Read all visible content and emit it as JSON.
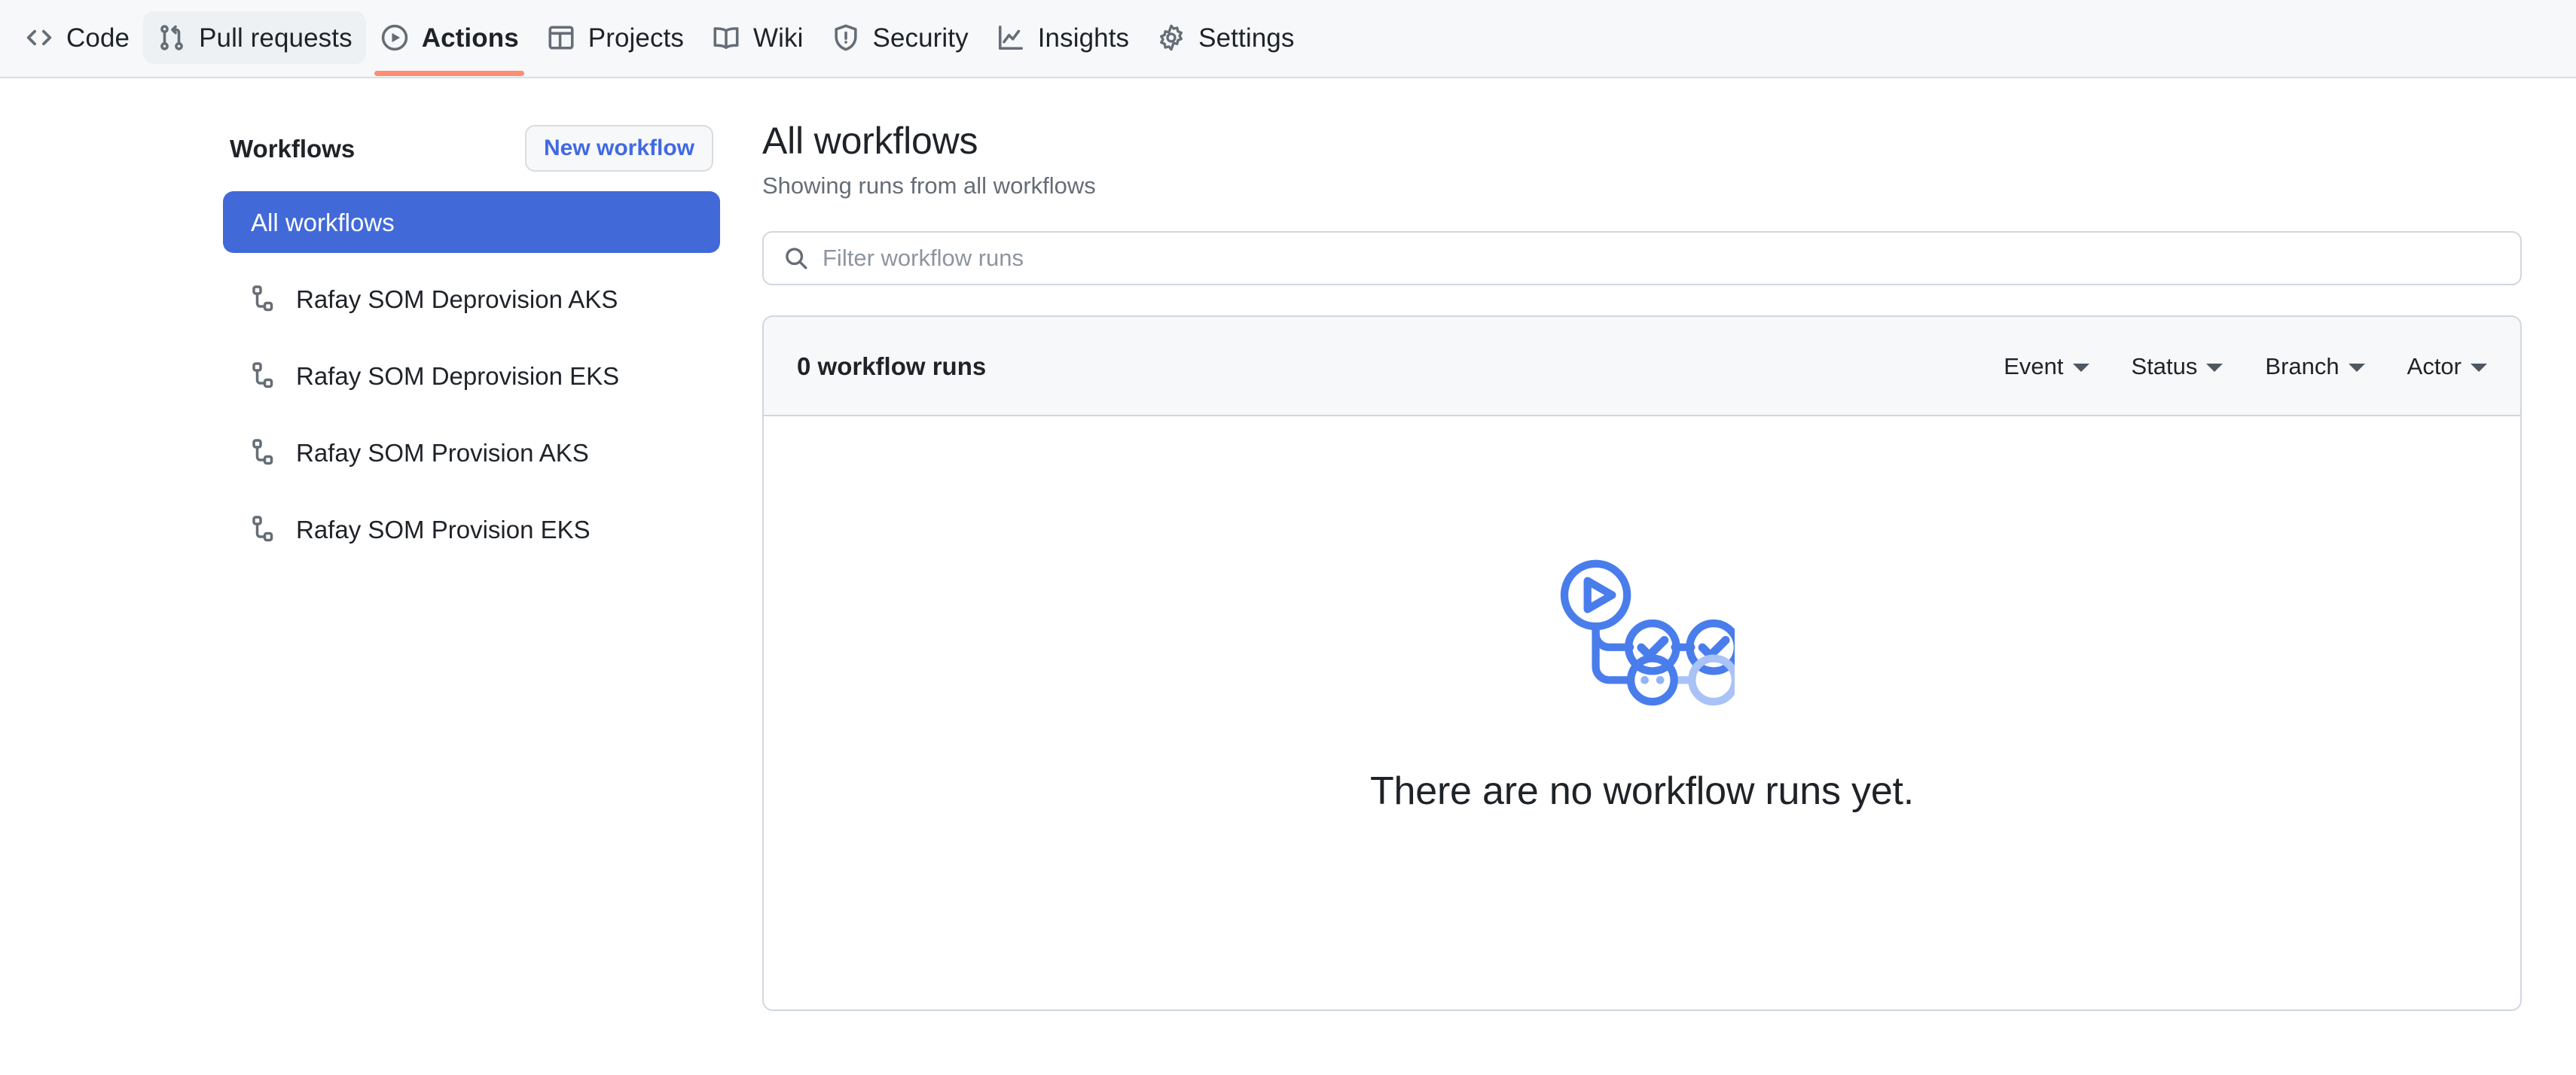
{
  "repo_nav": {
    "items": [
      {
        "label": "Code",
        "icon": "code-icon",
        "active": false,
        "hover": false
      },
      {
        "label": "Pull requests",
        "icon": "git-pull-request-icon",
        "active": false,
        "hover": true
      },
      {
        "label": "Actions",
        "icon": "play-circle-icon",
        "active": true,
        "hover": false
      },
      {
        "label": "Projects",
        "icon": "table-icon",
        "active": false,
        "hover": false
      },
      {
        "label": "Wiki",
        "icon": "book-icon",
        "active": false,
        "hover": false
      },
      {
        "label": "Security",
        "icon": "shield-alert-icon",
        "active": false,
        "hover": false
      },
      {
        "label": "Insights",
        "icon": "graph-icon",
        "active": false,
        "hover": false
      },
      {
        "label": "Settings",
        "icon": "gear-icon",
        "active": false,
        "hover": false
      }
    ],
    "active_underline_color": "#fd8c73"
  },
  "sidebar": {
    "title": "Workflows",
    "new_workflow_label": "New workflow",
    "new_workflow_color": "#4169e1",
    "selected_color": "#4169d8",
    "items": [
      {
        "label": "All workflows",
        "icon": null,
        "selected": true
      },
      {
        "label": "Rafay SOM Deprovision AKS",
        "icon": "workflow-icon",
        "selected": false
      },
      {
        "label": "Rafay SOM Deprovision EKS",
        "icon": "workflow-icon",
        "selected": false
      },
      {
        "label": "Rafay SOM Provision AKS",
        "icon": "workflow-icon",
        "selected": false
      },
      {
        "label": "Rafay SOM Provision EKS",
        "icon": "workflow-icon",
        "selected": false
      }
    ]
  },
  "main": {
    "title": "All workflows",
    "subtitle": "Showing runs from all workflows",
    "filter": {
      "icon": "search-icon",
      "placeholder": "Filter workflow runs",
      "value": ""
    },
    "runs": {
      "count_label": "0 workflow runs",
      "filters": [
        {
          "label": "Event",
          "icon": "chevron-down-icon"
        },
        {
          "label": "Status",
          "icon": "chevron-down-icon"
        },
        {
          "label": "Branch",
          "icon": "chevron-down-icon"
        },
        {
          "label": "Actor",
          "icon": "chevron-down-icon"
        }
      ],
      "empty_state": {
        "illustration": "workflow-runs-empty-icon",
        "message": "There are no workflow runs yet.",
        "accent_color": "#4a7dec",
        "accent_faded_color": "#a9c3f7"
      }
    }
  }
}
